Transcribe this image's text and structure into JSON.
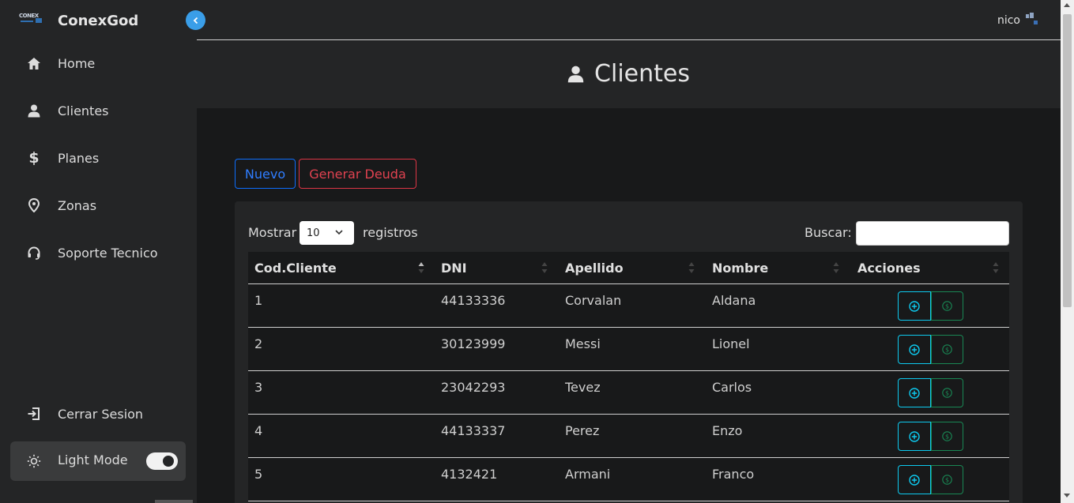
{
  "sidebar": {
    "brand": "ConexGod",
    "logo_text": "CONEX",
    "items": [
      {
        "label": "Home",
        "icon": "home-icon"
      },
      {
        "label": "Clientes",
        "icon": "user-icon"
      },
      {
        "label": "Planes",
        "icon": "dollar-icon"
      },
      {
        "label": "Zonas",
        "icon": "map-pin-icon"
      },
      {
        "label": "Soporte Tecnico",
        "icon": "headset-icon"
      }
    ],
    "logout": "Cerrar Sesion",
    "mode_label": "Light Mode",
    "mode_on": true
  },
  "topbar": {
    "username": "nico"
  },
  "page": {
    "title": "Clientes"
  },
  "actions": {
    "new": "Nuevo",
    "debt": "Generar Deuda"
  },
  "table_controls": {
    "show_prefix": "Mostrar",
    "page_length": "10",
    "show_suffix": "registros",
    "search_label": "Buscar:"
  },
  "table": {
    "columns": [
      "Cod.Cliente",
      "DNI",
      "Apellido",
      "Nombre",
      "Acciones"
    ],
    "rows": [
      {
        "cod": "1",
        "dni": "44133336",
        "apellido": "Corvalan",
        "nombre": "Aldana"
      },
      {
        "cod": "2",
        "dni": "30123999",
        "apellido": "Messi",
        "nombre": "Lionel"
      },
      {
        "cod": "3",
        "dni": "23042293",
        "apellido": "Tevez",
        "nombre": "Carlos"
      },
      {
        "cod": "4",
        "dni": "44133337",
        "apellido": "Perez",
        "nombre": "Enzo"
      },
      {
        "cod": "5",
        "dni": "4132421",
        "apellido": "Armani",
        "nombre": "Franco"
      }
    ]
  },
  "colors": {
    "sidebar_bg": "#242526",
    "body_bg": "#18191a",
    "accent_blue": "#3a9ee8",
    "primary": "#0d6efd",
    "danger": "#dc3545",
    "info": "#0dcaf0",
    "success": "#198754"
  }
}
